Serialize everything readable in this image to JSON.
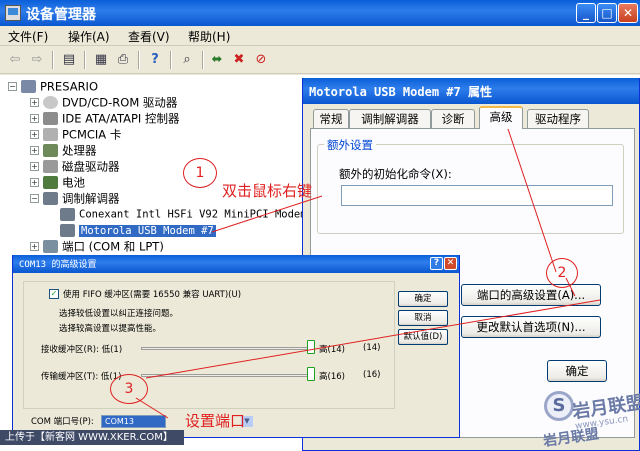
{
  "main_window": {
    "title": "设备管理器",
    "controls": {
      "minimize": "_",
      "maximize": "□",
      "close": "✕"
    }
  },
  "menu": [
    "文件(F)",
    "操作(A)",
    "查看(V)",
    "帮助(H)"
  ],
  "toolbar": [
    "back-icon",
    "forward-icon",
    "tree-view-icon",
    "properties-icon",
    "print-icon",
    "help-icon",
    "scan-hardware-icon",
    "update-driver-icon",
    "uninstall-icon",
    "disable-icon"
  ],
  "tree": {
    "root": "PRESARIO",
    "items": [
      "DVD/CD-ROM 驱动器",
      "IDE ATA/ATAPI 控制器",
      "PCMCIA 卡",
      "处理器",
      "磁盘驱动器",
      "电池",
      "调制解调器",
      "Conexant Intl HSFi V92 MiniPCI Modem",
      "Motorola USB Modem #7",
      "端口 (COM 和 LPT)"
    ]
  },
  "properties_dialog": {
    "title": "Motorola USB Modem #7 属性",
    "tabs": [
      "常规",
      "调制解调器",
      "诊断",
      "高级",
      "驱动程序"
    ],
    "active_tab": "高级",
    "group_title": "额外设置",
    "field_label": "额外的初始化命令(X):",
    "field_value": "",
    "advanced_port_button": "端口的高级设置(A)...",
    "defaults_button": "更改默认首选项(N)...",
    "ok_button": "确定"
  },
  "advanced_dialog": {
    "title": "COM13 的高级设置",
    "help_btn": "?",
    "close_btn": "✕",
    "fifo_checkbox": "使用 FIFO 缓冲区(需要 16550 兼容 UART)(U)",
    "fifo_checked": true,
    "hint1": "选择较低设置以纠正连接问题。",
    "hint2": "选择较高设置以提高性能。",
    "rx_label": "接收缓冲区(R): 低(1)",
    "rx_high": "高(14)",
    "rx_value": "(14)",
    "rx_level": 1.0,
    "tx_label": "传输缓冲区(T): 低(1)",
    "tx_high": "高(16)",
    "tx_value": "(16)",
    "tx_level": 1.0,
    "port_label": "COM 端口号(P):",
    "port_value": "COM13",
    "ok_button": "确定",
    "cancel_button": "取消",
    "defaults_button": "默认值(D)"
  },
  "annotations": {
    "circle1": "1",
    "circle2": "2",
    "circle3": "3",
    "note1": "双击鼠标右键",
    "note3": "设置端口"
  },
  "footer": "上传于【新客网 WWW.XKER.COM】",
  "watermark": {
    "badge": "S",
    "text": "岩月联盟",
    "sub": "www.ysu.cn",
    "text2": "岩月联盟"
  },
  "colors": {
    "title_blue": "#0A5FD8",
    "annotation_red": "#E02020",
    "selection": "#316AC5"
  }
}
